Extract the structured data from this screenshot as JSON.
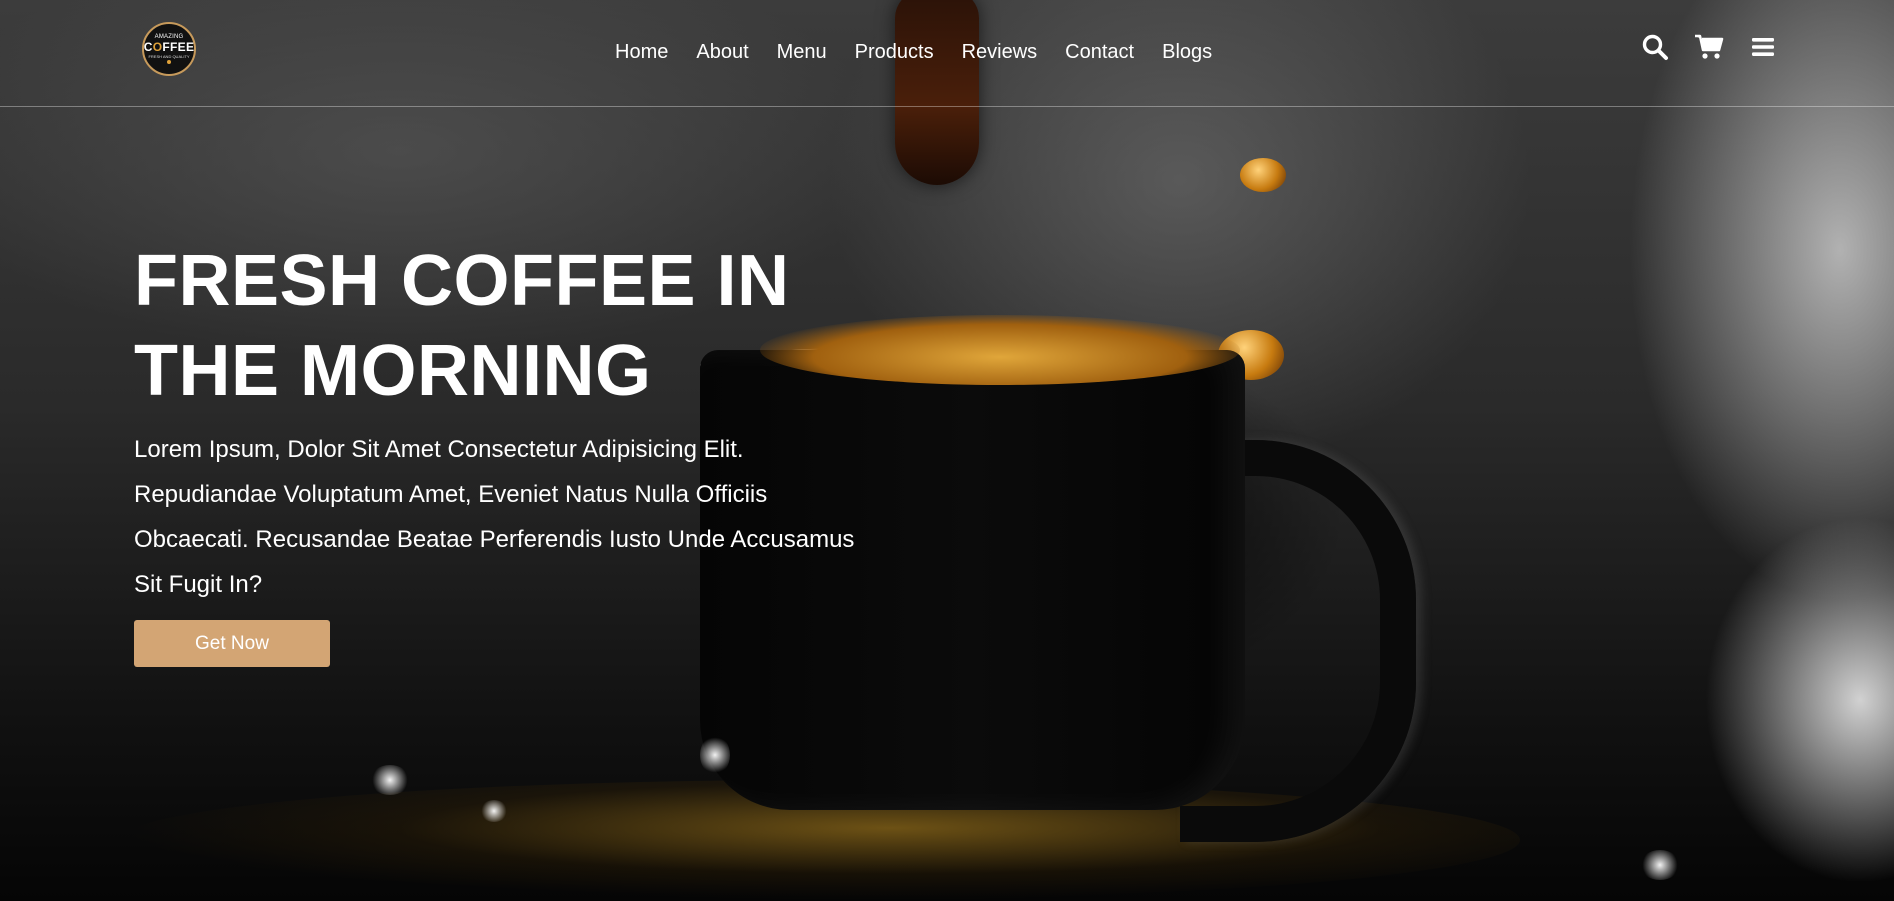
{
  "logo": {
    "top_text": "AMAZING",
    "main_text_before": "C",
    "main_text_o": "O",
    "main_text_after": "FFEE",
    "sub_text": "FRESH AND QUALITY"
  },
  "nav": {
    "items": [
      {
        "label": "Home"
      },
      {
        "label": "About"
      },
      {
        "label": "Menu"
      },
      {
        "label": "Products"
      },
      {
        "label": "Reviews"
      },
      {
        "label": "Contact"
      },
      {
        "label": "Blogs"
      }
    ]
  },
  "header_icons": [
    "search-icon",
    "cart-icon",
    "menu-bars-icon"
  ],
  "hero": {
    "title_line1": "FRESH COFFEE IN",
    "title_line2": "THE MORNING",
    "text": "Lorem Ipsum, Dolor Sit Amet Consectetur Adipisicing Elit. Repudiandae Voluptatum Amet, Eveniet Natus Nulla Officiis Obcaecati. Recusandae Beatae Perferendis Iusto Unde Accusamus Sit Fugit In?",
    "cta_label": "Get Now"
  },
  "colors": {
    "accent": "#d3a574",
    "text": "#ffffff",
    "logo_gold": "#e0a23a"
  }
}
